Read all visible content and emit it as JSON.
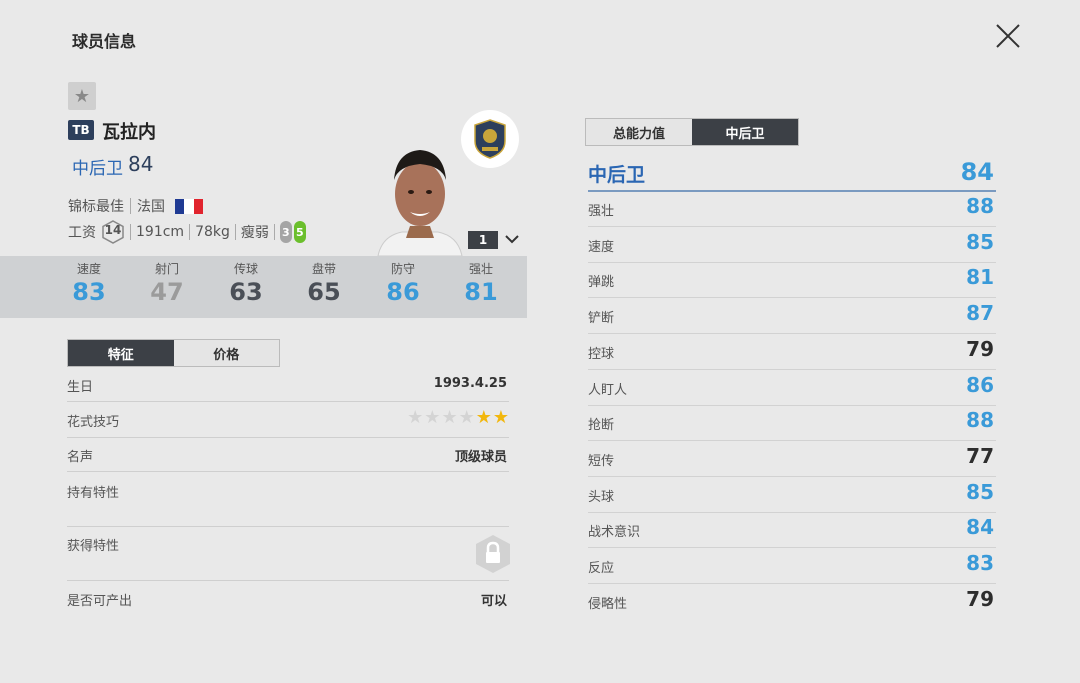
{
  "window": {
    "title": "球员信息"
  },
  "player": {
    "season_badge": "TB",
    "name": "瓦拉内",
    "position": "中后卫",
    "overall": "84",
    "team": "锦标最佳",
    "nation": "法国",
    "wage": "14",
    "height": "191cm",
    "weight": "78kg",
    "build": "瘦弱",
    "weak_foot": "3",
    "strong_foot": "5",
    "level": "1"
  },
  "colors": {
    "high": "#3a9ad8",
    "mid": "#2d3f5c",
    "low": "#9b9b9b",
    "position_blue": "#2a66b3"
  },
  "stats": [
    {
      "label": "速度",
      "value": "83",
      "color": "#3a9ad8"
    },
    {
      "label": "射门",
      "value": "47",
      "color": "#9b9b9b"
    },
    {
      "label": "传球",
      "value": "63",
      "color": "#4a4f57"
    },
    {
      "label": "盘带",
      "value": "65",
      "color": "#4a4f57"
    },
    {
      "label": "防守",
      "value": "86",
      "color": "#3a9ad8"
    },
    {
      "label": "强壮",
      "value": "81",
      "color": "#3a9ad8"
    }
  ],
  "left_tabs": [
    {
      "label": "特征",
      "active": true
    },
    {
      "label": "价格",
      "active": false
    }
  ],
  "traits": {
    "birthday_label": "生日",
    "birthday_value": "1993.4.25",
    "skill_label": "花式技巧",
    "skill_stars": 2,
    "skill_max": 6,
    "reputation_label": "名声",
    "reputation_value": "顶级球员",
    "owned_traits_label": "持有特性",
    "obtained_traits_label": "获得特性",
    "tradable_label": "是否可产出",
    "tradable_value": "可以"
  },
  "right_tabs": [
    {
      "label": "总能力值",
      "active": false
    },
    {
      "label": "中后卫",
      "active": true
    }
  ],
  "attributes": {
    "header_name": "中后卫",
    "header_value": "84",
    "rows": [
      {
        "name": "强壮",
        "value": "88",
        "color": "#3a9ad8"
      },
      {
        "name": "速度",
        "value": "85",
        "color": "#3a9ad8"
      },
      {
        "name": "弹跳",
        "value": "81",
        "color": "#3a9ad8"
      },
      {
        "name": "铲断",
        "value": "87",
        "color": "#3a9ad8"
      },
      {
        "name": "控球",
        "value": "79",
        "color": "#2d2d2d"
      },
      {
        "name": "人盯人",
        "value": "86",
        "color": "#3a9ad8"
      },
      {
        "name": "抢断",
        "value": "88",
        "color": "#3a9ad8"
      },
      {
        "name": "短传",
        "value": "77",
        "color": "#2d2d2d"
      },
      {
        "name": "头球",
        "value": "85",
        "color": "#3a9ad8"
      },
      {
        "name": "战术意识",
        "value": "84",
        "color": "#3a9ad8"
      },
      {
        "name": "反应",
        "value": "83",
        "color": "#3a9ad8"
      },
      {
        "name": "侵略性",
        "value": "79",
        "color": "#2d2d2d"
      }
    ]
  }
}
